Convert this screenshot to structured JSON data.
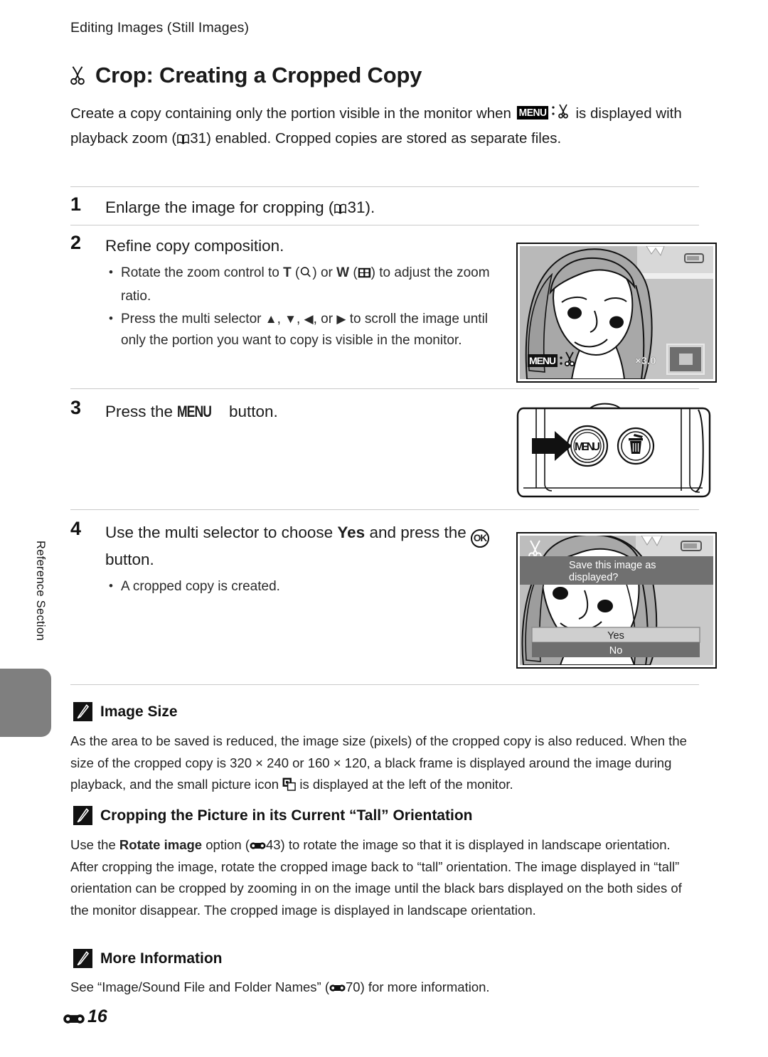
{
  "page": {
    "running_head": "Editing Images (Still Images)",
    "chapter_title": "Crop: Creating a Cropped Copy",
    "chapter_icon": "scissors-icon",
    "folio_number": "16",
    "side_tab_label": "Reference Section"
  },
  "intro": {
    "part1": "Create a copy containing only the portion visible in the monitor when ",
    "menu_badge": "MENU",
    "part2": " is displayed with playback zoom (",
    "ref1": "31",
    "part3": ") enabled. Cropped copies are stored as separate files."
  },
  "steps": [
    {
      "number": "1",
      "title_a": "Enlarge the image for cropping (",
      "title_b": "31).",
      "bullets": []
    },
    {
      "number": "2",
      "title": "Refine copy composition.",
      "bullets": [
        {
          "a": "Rotate the zoom control to ",
          "t": "T",
          "b": " (",
          "c": ") or ",
          "w": "W",
          "d": " (",
          "e": ") to adjust the zoom ratio."
        },
        {
          "a": "Press the multi selector ",
          "b": ", ",
          "c": ", ",
          "d": ", or ",
          "e": " to scroll the image until only the portion you want to copy is visible in the monitor."
        }
      ]
    },
    {
      "number": "3",
      "title_a": "Press the ",
      "menu": "MENU",
      "title_b": " button.",
      "bullets": []
    },
    {
      "number": "4",
      "title_a": "Use the multi selector to choose ",
      "yes": "Yes",
      "title_b": " and press the ",
      "ok": "OK",
      "title_c": " button.",
      "bullets": [
        {
          "text": "A cropped copy is created."
        }
      ]
    }
  ],
  "figures": {
    "monitor_1": {
      "menu_label": "MENU",
      "zoom_ratio": "×3.0",
      "battery_icon": "battery-icon",
      "scissors_icon": "scissors-icon",
      "navigation_thumb": "navigation-thumbnail"
    },
    "camera_back": {
      "menu_button_label": "MENU",
      "delete_button_icon": "trash-icon",
      "pointer_icon": "arrow-right-icon"
    },
    "monitor_2": {
      "dialog_line1": "Save this image as",
      "dialog_line2": "displayed?",
      "option_yes": "Yes",
      "option_no": "No",
      "scissors_icon": "scissors-icon",
      "battery_icon": "battery-icon"
    }
  },
  "notes": [
    {
      "icon": "pencil-note-icon",
      "title": "Image Size",
      "body_a": "As the area to be saved is reduced, the image size (pixels) of the cropped copy is also reduced. When the size of the cropped copy is 320 × 240 or 160 × 120, a black frame is displayed around the image during playback, and the small picture icon ",
      "body_b": " is displayed at the left of the monitor."
    },
    {
      "icon": "pencil-note-icon",
      "title": "Cropping the Picture in its Current “Tall” Orientation",
      "body_a": "Use the ",
      "bold_term": "Rotate image",
      "body_b": " option (",
      "ref": "43",
      "body_c": ") to rotate the image so that it is displayed in landscape orientation. After cropping the image, rotate the cropped image back to “tall” orientation. The image displayed in “tall” orientation can be cropped by zooming in on the image until the black bars displayed on the both sides of the monitor disappear. The cropped image is displayed in landscape orientation."
    },
    {
      "icon": "pencil-note-icon",
      "title": "More Information",
      "body_a": "See “Image/Sound File and Folder Names” (",
      "ref": "70",
      "body_b": ") for more information."
    }
  ],
  "colors": {
    "rule": "#c9c9c9",
    "tab_gray": "#7f7f7f",
    "text": "#1c1c1c"
  }
}
